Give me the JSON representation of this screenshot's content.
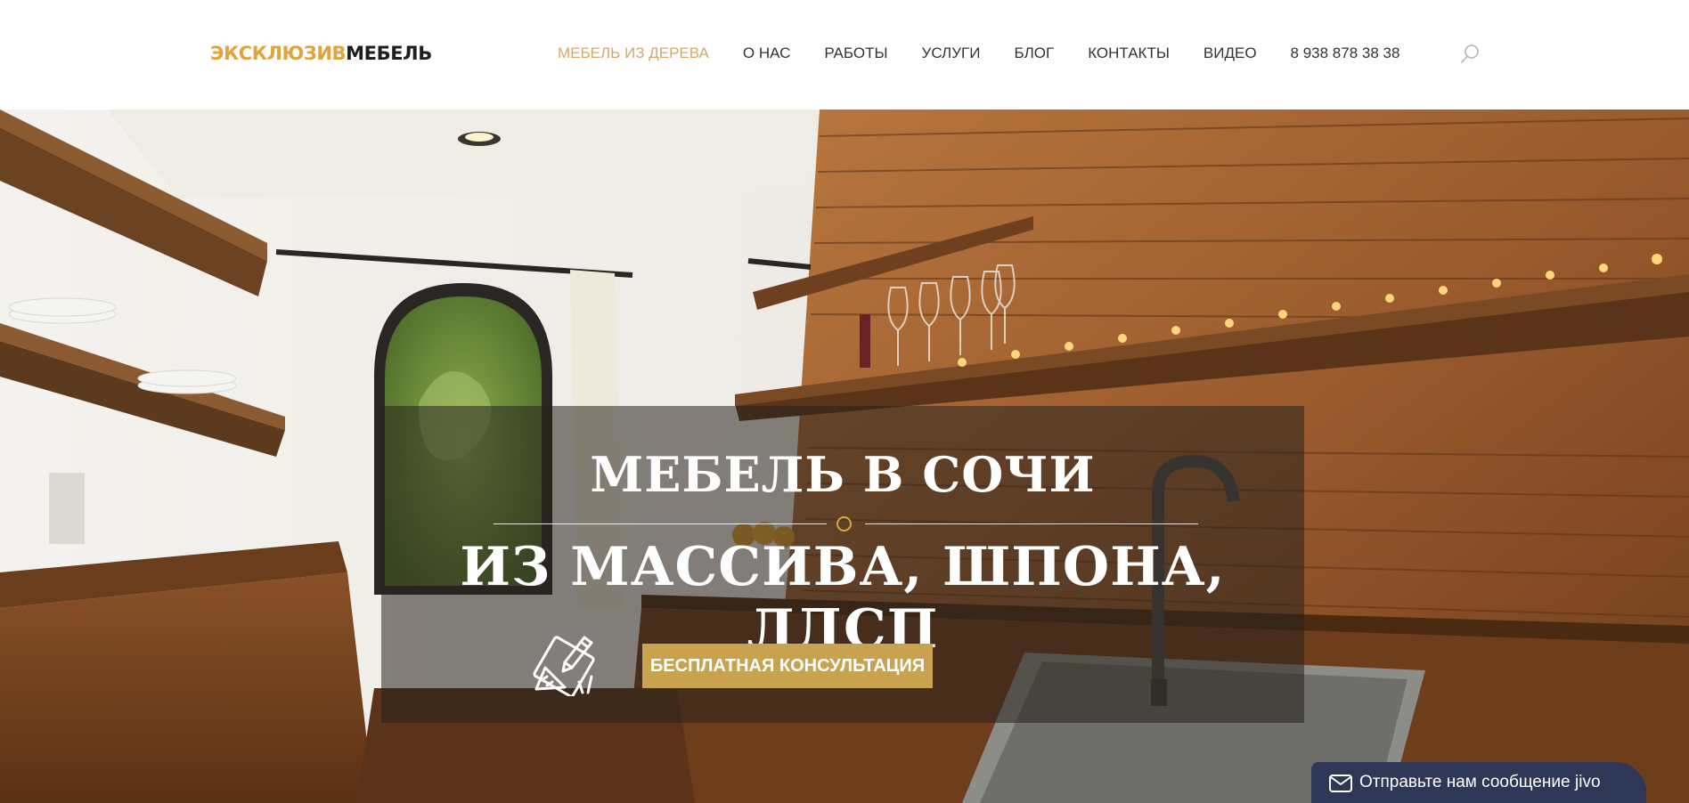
{
  "logo": {
    "accent": "ЭКСКЛЮЗИВ",
    "dark": "МЕБЕЛЬ"
  },
  "nav": {
    "items": [
      {
        "label": "МЕБЕЛЬ ИЗ ДЕРЕВА",
        "active": true
      },
      {
        "label": "О НАС"
      },
      {
        "label": "РАБОТЫ"
      },
      {
        "label": "УСЛУГИ"
      },
      {
        "label": "БЛОГ"
      },
      {
        "label": "КОНТАКТЫ"
      },
      {
        "label": "ВИДЕО"
      },
      {
        "label": "8 938 878 38 38"
      }
    ],
    "search_icon": "search-icon"
  },
  "hero": {
    "title_line1": "МЕБЕЛЬ В СОЧИ",
    "title_line2": "ИЗ МАССИВА, ШПОНА, ЛДСП",
    "cta_label": "БЕСПЛАТНАЯ КОНСУЛЬТАЦИЯ",
    "design_icon": "design-tools-icon"
  },
  "chat": {
    "message": "Отправьте нам сообщение",
    "brand": "jivo",
    "icon": "mail-icon"
  },
  "colors": {
    "accent": "#e0a43a",
    "nav_active": "#d6a86a",
    "cta": "#c8a24f",
    "chat_bg": "#2e3856"
  }
}
